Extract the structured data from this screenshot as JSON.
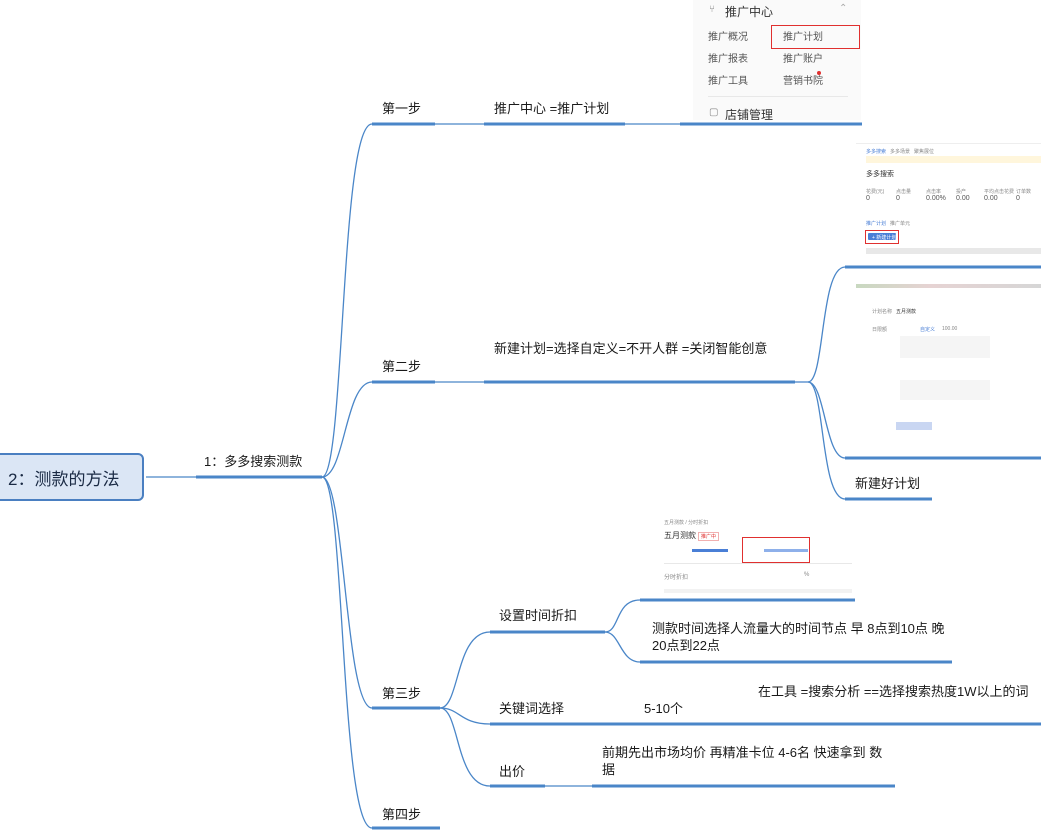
{
  "root": {
    "label": "2：测款的方法"
  },
  "branch": {
    "label": "1：多多搜索测款"
  },
  "steps": [
    {
      "label": "第一步"
    },
    {
      "label": "第二步"
    },
    {
      "label": "第三步"
    },
    {
      "label": "第四步"
    }
  ],
  "step1": {
    "detail": "推广中心 =推广计划"
  },
  "step2": {
    "detail": "新建计划=选择自定义=不开人群 =关闭智能创意",
    "result": "新建好计划"
  },
  "step3": {
    "time": {
      "label": "设置时间折扣",
      "detail": "测款时间选择人流量大的时间节点 早 8点到10点 晚20点到22点"
    },
    "keyword": {
      "label": "关键词选择",
      "count": "5-10个",
      "detail": "在工具 =搜索分析 ==选择搜索热度1W以上的词"
    },
    "bid": {
      "label": "出价",
      "detail": "前期先出市场均价 再精准卡位 4-6名 快速拿到 数据"
    }
  },
  "menu_shot": {
    "title": "推广中心",
    "items": [
      [
        "推广概况",
        "推广计划"
      ],
      [
        "推广报表",
        "推广账户"
      ],
      [
        "推广工具",
        "营销书院"
      ]
    ],
    "next": "店铺管理"
  },
  "search_shot": {
    "tabs": [
      "多多搜索",
      "多多场景",
      "聚焦展位"
    ],
    "title": "多多搜索",
    "metrics": [
      [
        "花费(元)",
        "0"
      ],
      [
        "点击量",
        "0"
      ],
      [
        "点击率",
        "0.00%"
      ],
      [
        "投产",
        "0.00"
      ],
      [
        "平均点击花费",
        "0.00"
      ],
      [
        "订单数",
        "0"
      ]
    ],
    "list_tabs": [
      "推广计划",
      "推广单元"
    ],
    "new_button": "+ 新建计划"
  },
  "plan_shot": {
    "name_label": "计划名称",
    "name_value": "五月测款",
    "date_label": "日限额",
    "custom_label": "自定义",
    "budget_value": "100.00"
  },
  "discount_shot": {
    "crumb": "五月测款 / 分时折扣",
    "title": "五月测款",
    "badge": "推广中",
    "section": "分时折扣",
    "unit": "%"
  },
  "colors": {
    "line": "#4a86c8",
    "red": "#e0302f",
    "accent": "#4a7fd6"
  }
}
